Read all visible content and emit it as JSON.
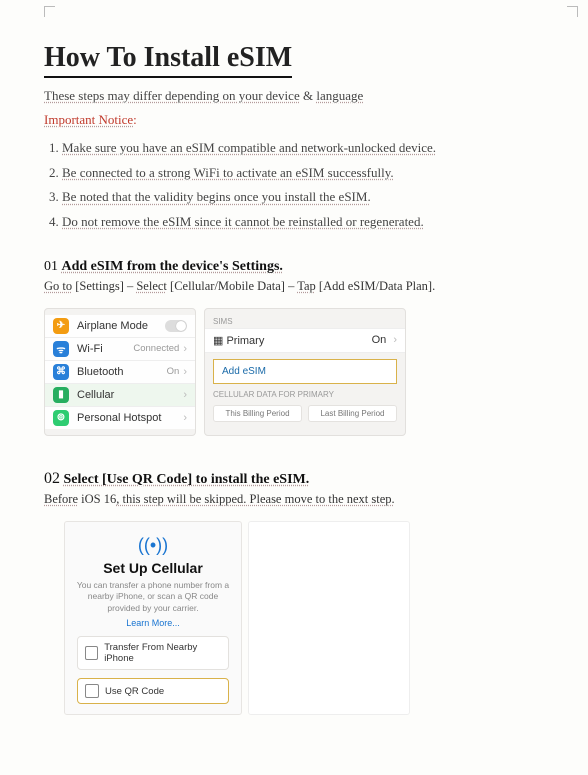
{
  "title": "How To Install eSIM",
  "subtitle_a": "These steps may differ depending on your device",
  "subtitle_amp": "&",
  "subtitle_b": "language",
  "important": "Important Notice",
  "notices": [
    "Make sure you have an eSIM compatible and network-unlocked device.",
    "Be connected to a strong WiFi to activate an eSIM successfully.",
    "Be noted that the validity begins once you install the eSIM.",
    "Do not remove the eSIM since it cannot be reinstalled or regenerated."
  ],
  "step1": {
    "num": "01",
    "title": "Add eSIM from the device's Settings.",
    "go": "Go to",
    "settings": "[Settings]",
    "dash1": " – ",
    "select": "Select",
    "cell": "[Cellular/Mobile Data]",
    "dash2": " – ",
    "tap": "Tap",
    "add": "[Add eSIM/Data Plan]",
    "dot": "."
  },
  "ios_left": {
    "airplane": "Airplane Mode",
    "wifi": "Wi-Fi",
    "wifi_r": "Connected",
    "bt": "Bluetooth",
    "bt_r": "On",
    "cellular": "Cellular",
    "hotspot": "Personal Hotspot"
  },
  "ios_right": {
    "sims": "SIMs",
    "primary": "Primary",
    "on": "On",
    "add": "Add eSIM",
    "cdp": "CELLULAR DATA FOR PRIMARY",
    "tb": "This Billing Period",
    "lb": "Last Billing Period"
  },
  "step2": {
    "num": "02",
    "title": "Select [Use QR Code] to install the eSIM.",
    "before": "Before",
    "ios": "iOS 16",
    "rest": ", this step will be skipped. Please move to the next step."
  },
  "setup": {
    "heading": "Set Up Cellular",
    "desc": "You can transfer a phone number from a nearby iPhone, or scan a QR code provided by your carrier.",
    "learn": "Learn More...",
    "transfer": "Transfer From Nearby iPhone",
    "qr": "Use QR Code"
  }
}
